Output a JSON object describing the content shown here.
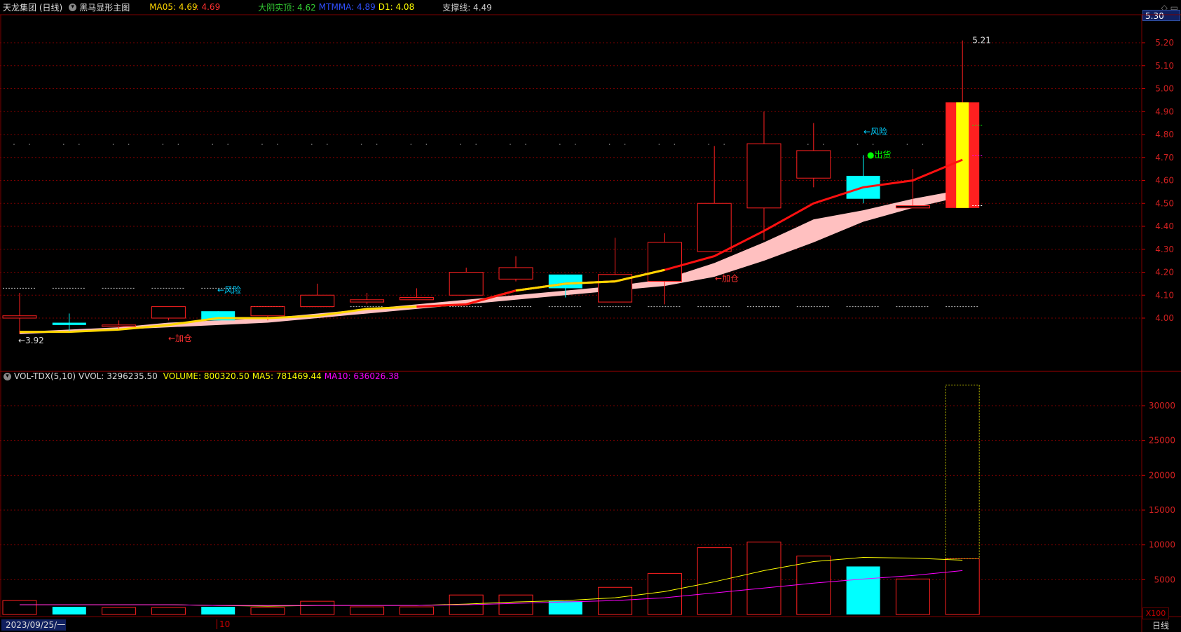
{
  "main_header": {
    "stock": "天龙集团 (日线)",
    "indicator": "黑马显形主图",
    "ma05_label": "MA05: 4.69",
    "ma05_value": ": 4.69",
    "dayin_label": "大阴实顶: 4.62",
    "mtmma_label": "MTMMA: 4.89",
    "d1_label": "D1: 4.08",
    "support_label": "支撑线: 4.49"
  },
  "vol_header": {
    "name": "VOL-TDX(5,10)",
    "vvol": "VVOL: 3296235.50",
    "volume": "VOLUME: 800320.50",
    "ma5": "MA5: 781469.44",
    "ma10": "MA10: 636026.38"
  },
  "price_axis": [
    "5.20",
    "5.10",
    "5.00",
    "4.90",
    "4.80",
    "4.70",
    "4.60",
    "4.50",
    "4.40",
    "4.30",
    "4.20",
    "4.10",
    "4.00"
  ],
  "current_price_box": "5.30",
  "vol_axis": [
    "30000",
    "25000",
    "20000",
    "15000",
    "10000",
    "5000"
  ],
  "unit_label": "X100",
  "period_label": "日线",
  "date_label": "2023/09/25/一",
  "tick_label": "10",
  "top_right_icons": "◇ ▭",
  "annotations": {
    "low_price": "←3.92",
    "high_price": "5.21",
    "risk1": "←风险",
    "add1": "←加仓",
    "add2": "←加仓",
    "risk2": "←风险",
    "sell": "●出货"
  },
  "colors": {
    "up": "#ff2020",
    "down": "#00ffff",
    "ma_yellow": "#ffd700",
    "ma_magenta": "#ff00ff",
    "band": "#ffc0c0",
    "grid": "#7a0000"
  },
  "chart_data": {
    "type": "candlestick",
    "candles": [
      {
        "o": 4.0,
        "h": 4.11,
        "l": 3.93,
        "c": 4.01
      },
      {
        "o": 3.98,
        "h": 4.02,
        "l": 3.94,
        "c": 3.97
      },
      {
        "o": 3.97,
        "h": 3.99,
        "l": 3.95,
        "c": 3.97
      },
      {
        "o": 4.0,
        "h": 4.05,
        "l": 3.99,
        "c": 4.05
      },
      {
        "o": 4.03,
        "h": 4.03,
        "l": 3.99,
        "c": 3.99
      },
      {
        "o": 4.01,
        "h": 4.05,
        "l": 3.99,
        "c": 4.05
      },
      {
        "o": 4.05,
        "h": 4.15,
        "l": 4.05,
        "c": 4.1
      },
      {
        "o": 4.07,
        "h": 4.11,
        "l": 4.06,
        "c": 4.08
      },
      {
        "o": 4.08,
        "h": 4.13,
        "l": 4.08,
        "c": 4.09
      },
      {
        "o": 4.1,
        "h": 4.22,
        "l": 4.1,
        "c": 4.2
      },
      {
        "o": 4.17,
        "h": 4.27,
        "l": 4.16,
        "c": 4.22
      },
      {
        "o": 4.19,
        "h": 4.19,
        "l": 4.09,
        "c": 4.13
      },
      {
        "o": 4.07,
        "h": 4.35,
        "l": 4.07,
        "c": 4.19
      },
      {
        "o": 4.16,
        "h": 4.37,
        "l": 4.06,
        "c": 4.33
      },
      {
        "o": 4.29,
        "h": 4.75,
        "l": 4.29,
        "c": 4.5
      },
      {
        "o": 4.48,
        "h": 4.9,
        "l": 4.34,
        "c": 4.76
      },
      {
        "o": 4.61,
        "h": 4.85,
        "l": 4.57,
        "c": 4.73
      },
      {
        "o": 4.62,
        "h": 4.71,
        "l": 4.5,
        "c": 4.52
      },
      {
        "o": 4.48,
        "h": 4.65,
        "l": 4.48,
        "c": 4.49
      },
      {
        "o": 4.48,
        "h": 5.21,
        "l": 4.48,
        "c": 4.94
      }
    ],
    "ma05": [
      3.94,
      3.94,
      3.95,
      3.97,
      4.0,
      4.0,
      4.01,
      4.04,
      4.05,
      4.06,
      4.12,
      4.15,
      4.16,
      4.21,
      4.27,
      4.38,
      4.5,
      4.57,
      4.6,
      4.69
    ],
    "band_upper": [
      3.94,
      3.95,
      3.96,
      3.98,
      3.99,
      4.0,
      4.02,
      4.04,
      4.06,
      4.08,
      4.1,
      4.12,
      4.14,
      4.17,
      4.24,
      4.33,
      4.43,
      4.47,
      4.52,
      4.56
    ],
    "band_lower": [
      3.93,
      3.94,
      3.95,
      3.96,
      3.97,
      3.98,
      4.0,
      4.02,
      4.04,
      4.06,
      4.08,
      4.1,
      4.12,
      4.14,
      4.18,
      4.25,
      4.33,
      4.42,
      4.48,
      4.53
    ],
    "dashed_levels": [
      4.13,
      4.05
    ],
    "volume": [
      2000,
      1100,
      1000,
      1000,
      1100,
      1000,
      1900,
      1100,
      1100,
      2800,
      2800,
      1900,
      3900,
      5900,
      9600,
      10400,
      8400,
      6900,
      5100,
      8003
    ],
    "volume_up": [
      true,
      false,
      true,
      true,
      false,
      true,
      true,
      true,
      true,
      true,
      true,
      false,
      true,
      true,
      true,
      true,
      true,
      false,
      true,
      true
    ],
    "vvol": 32962,
    "vol_ma5": [
      1400,
      1400,
      1400,
      1400,
      1300,
      1200,
      1300,
      1300,
      1300,
      1500,
      1800,
      2000,
      2400,
      3300,
      4700,
      6300,
      7600,
      8200,
      8100,
      7800
    ],
    "vol_ma10": [
      1400,
      1400,
      1400,
      1400,
      1300,
      1300,
      1300,
      1300,
      1300,
      1400,
      1600,
      1800,
      2000,
      2400,
      3100,
      3800,
      4500,
      5100,
      5600,
      6300
    ]
  }
}
